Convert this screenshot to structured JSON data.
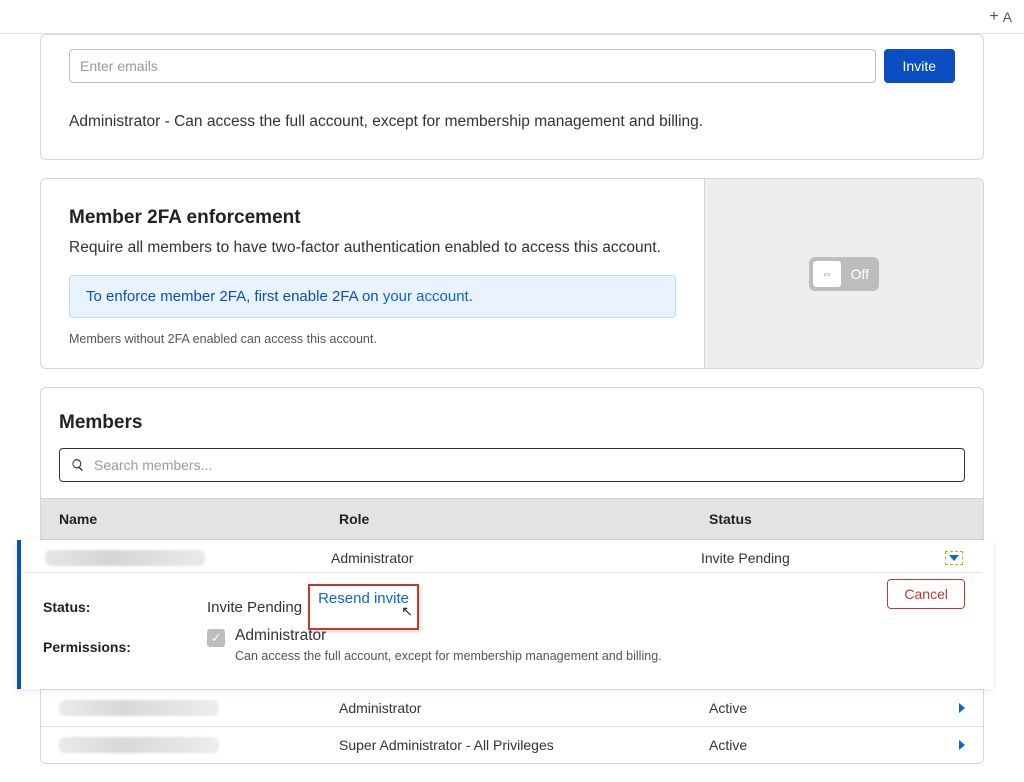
{
  "topbar": {
    "glyph": "+",
    "letter": "A"
  },
  "invite": {
    "placeholder": "Enter emails",
    "button": "Invite",
    "desc": "Administrator - Can access the full account, except for membership management and billing."
  },
  "tfa": {
    "heading": "Member 2FA enforcement",
    "sub": "Require all members to have two-factor authentication enabled to access this account.",
    "info_pre": "To enforce member 2FA, first enable 2FA on ",
    "info_link": "your account",
    "info_post": ".",
    "note": "Members without 2FA enabled can access this account.",
    "toggle_glyph": "⇔",
    "toggle_label": "Off"
  },
  "members": {
    "heading": "Members",
    "search_placeholder": "Search members...",
    "columns": {
      "name": "Name",
      "role": "Role",
      "status": "Status"
    },
    "expanded": {
      "role": "Administrator",
      "status": "Invite Pending",
      "labels": {
        "status": "Status:",
        "permissions": "Permissions:"
      },
      "status_value": "Invite Pending",
      "resend": "Resend invite",
      "cancel": "Cancel",
      "perm_title": "Administrator",
      "perm_desc": "Can access the full account, except for membership management and billing."
    },
    "rows": [
      {
        "role": "Administrator",
        "status": "Active"
      },
      {
        "role": "Super Administrator - All Privileges",
        "status": "Active"
      }
    ]
  }
}
